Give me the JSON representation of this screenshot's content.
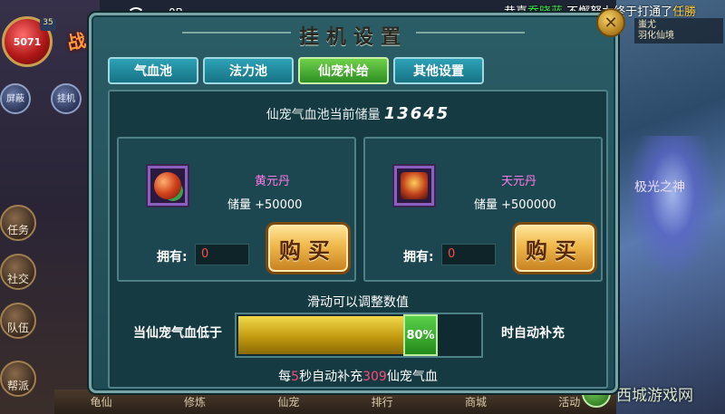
{
  "hud": {
    "hp_value": "5071",
    "level": "35",
    "battle_glyph": "战",
    "side_buttons": [
      "屏蔽",
      "挂机"
    ],
    "left_buttons": [
      "任务",
      "社交",
      "队伍",
      "帮派"
    ],
    "network_speed": "0B",
    "marquee_prefix": "恭喜",
    "marquee_name": "乔晓蓝",
    "marquee_suffix": ",不懈努力终于打通了",
    "marquee_tail": "任勝",
    "top_right_line1": "蚩尤",
    "top_right_line2": "羽化仙境",
    "enemy_label": "极光之神",
    "bottom_items": [
      "龟仙",
      "修炼",
      "仙宠",
      "排行",
      "商城",
      "活动"
    ],
    "watermark": "西城游戏网"
  },
  "dialog": {
    "title": "挂机设置",
    "close_symbol": "✕",
    "tabs": [
      {
        "label": "气血池",
        "active": false
      },
      {
        "label": "法力池",
        "active": false
      },
      {
        "label": "仙宠补给",
        "active": true
      },
      {
        "label": "其他设置",
        "active": false
      }
    ],
    "reserve_label": "仙宠气血池当前储量",
    "reserve_value": "13645",
    "items": [
      {
        "name": "黄元丹",
        "stock": "储量 +50000",
        "own_label": "拥有:",
        "owned": "0",
        "buy_label": "购买",
        "icon": "pill-icon"
      },
      {
        "name": "天元丹",
        "stock": "储量 +500000",
        "own_label": "拥有:",
        "owned": "0",
        "buy_label": "购买",
        "icon": "treasure-box-icon"
      }
    ],
    "slider_hint": "滑动可以调整数值",
    "threshold_prefix": "当仙宠气血低于",
    "threshold_suffix": "时自动补充",
    "threshold_value": 0.8,
    "threshold_text": "80%",
    "refill": {
      "t1": "每",
      "seconds": "5",
      "t2": "秒自动补充",
      "amount": "309",
      "t3": "仙宠气血"
    }
  },
  "colors": {
    "tab_active": "#2c8f22",
    "tab_inactive": "#177385",
    "item_name": "#ff7ae8",
    "owned_value": "#ff4a4a",
    "refill_highlight": "#ff4a7a"
  }
}
